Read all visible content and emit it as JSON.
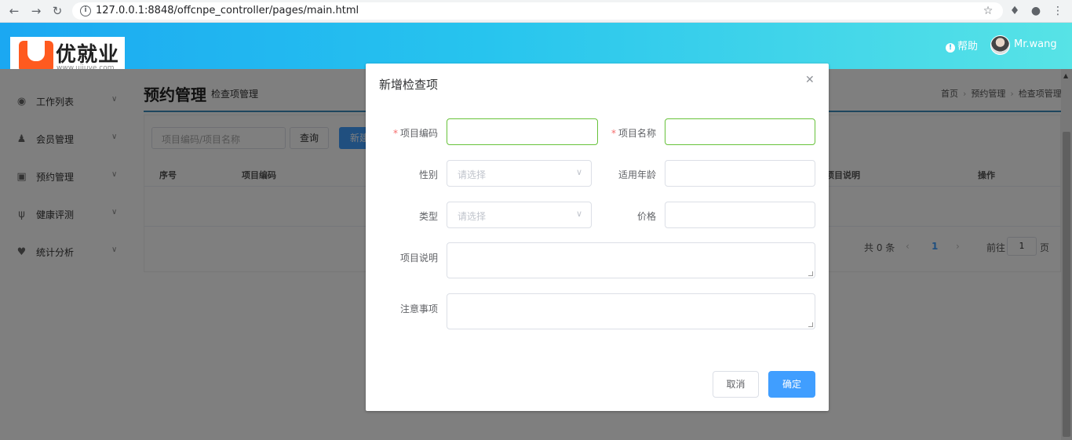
{
  "browser": {
    "url": "127.0.0.1:8848/offcnpe_controller/pages/main.html"
  },
  "header": {
    "logo_name": "优就业",
    "logo_url": "www.ujiuye.com",
    "help_label": "帮助",
    "user_name": "Mr.wang"
  },
  "sidebar": {
    "items": [
      {
        "label": "工作列表",
        "icon": "dashboard-icon"
      },
      {
        "label": "会员管理",
        "icon": "member-icon"
      },
      {
        "label": "预约管理",
        "icon": "reservation-icon"
      },
      {
        "label": "健康评测",
        "icon": "stethoscope-icon"
      },
      {
        "label": "统计分析",
        "icon": "heart-pulse-icon"
      }
    ]
  },
  "main": {
    "title": "预约管理",
    "subtitle": "检查项管理",
    "breadcrumb": [
      "首页",
      "预约管理",
      "检查项管理"
    ],
    "search_placeholder": "项目编码/项目名称",
    "query_button": "查询",
    "new_button": "新建",
    "columns": [
      "序号",
      "项目编码",
      "项目说明",
      "操作"
    ],
    "pager": {
      "total_text": "共 0 条",
      "current_page": "1",
      "goto_label": "前往",
      "goto_value": "1",
      "page_suffix": "页"
    }
  },
  "dialog": {
    "title": "新增检查项",
    "fields": {
      "code_label": "项目编码",
      "name_label": "项目名称",
      "gender_label": "性别",
      "gender_placeholder": "请选择",
      "age_label": "适用年龄",
      "type_label": "类型",
      "type_placeholder": "请选择",
      "price_label": "价格",
      "desc_label": "项目说明",
      "note_label": "注意事项"
    },
    "cancel_button": "取消",
    "confirm_button": "确定"
  },
  "colors": {
    "primary": "#409eff",
    "header_gradient_start": "#1ba8f2",
    "header_gradient_end": "#57e3e6",
    "required": "#f56c6c",
    "focus_border": "#67c23a"
  }
}
